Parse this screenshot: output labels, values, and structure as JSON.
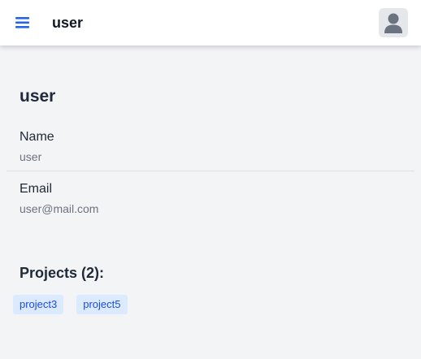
{
  "header": {
    "title": "user",
    "menu_icon": "hamburger-menu-icon",
    "avatar_icon": "user-avatar-icon",
    "accent_color": "#2563eb"
  },
  "profile": {
    "heading": "user",
    "name_label": "Name",
    "name_value": "user",
    "email_label": "Email",
    "email_value": "user@mail.com"
  },
  "projects": {
    "heading": "Projects (2):",
    "items": [
      {
        "label": "project3"
      },
      {
        "label": "project5"
      }
    ],
    "chip_bg": "#dbeafe",
    "chip_text": "#1d4ed8"
  }
}
